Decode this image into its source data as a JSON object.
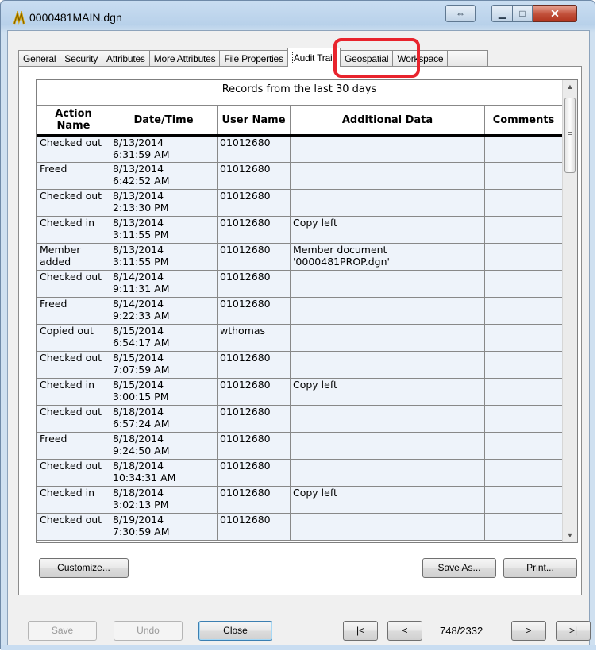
{
  "window": {
    "title": "0000481MAIN.dgn",
    "resize_glyph": "⇔",
    "minimize_glyph": "▁",
    "maximize_glyph": "□",
    "close_glyph": "✕"
  },
  "tabs": [
    {
      "label": "General"
    },
    {
      "label": "Security"
    },
    {
      "label": "Attributes"
    },
    {
      "label": "More Attributes"
    },
    {
      "label": "File Properties"
    },
    {
      "label": "Audit Trail",
      "active": true
    },
    {
      "label": "Geospatial"
    },
    {
      "label": "Workspace"
    },
    {
      "label": ""
    }
  ],
  "grid": {
    "caption": "Records from the last 30 days",
    "columns": {
      "action": "Action Name",
      "datetime": "Date/Time",
      "user": "User Name",
      "additional": "Additional Data",
      "comments": "Comments"
    },
    "rows": [
      {
        "action": "Checked out",
        "date": "8/13/2014",
        "time": "6:31:59 AM",
        "user": "01012680",
        "additional": "",
        "comments": ""
      },
      {
        "action": "Freed",
        "date": "8/13/2014",
        "time": "6:42:52 AM",
        "user": "01012680",
        "additional": "",
        "comments": ""
      },
      {
        "action": "Checked out",
        "date": "8/13/2014",
        "time": "2:13:30 PM",
        "user": "01012680",
        "additional": "",
        "comments": ""
      },
      {
        "action": "Checked in",
        "date": "8/13/2014",
        "time": "3:11:55 PM",
        "user": "01012680",
        "additional": "Copy left",
        "comments": ""
      },
      {
        "action": "Member added",
        "date": "8/13/2014",
        "time": "3:11:55 PM",
        "user": "01012680",
        "additional": "Member document '0000481PROP.dgn'",
        "comments": ""
      },
      {
        "action": "Checked out",
        "date": "8/14/2014",
        "time": "9:11:31 AM",
        "user": "01012680",
        "additional": "",
        "comments": ""
      },
      {
        "action": "Freed",
        "date": "8/14/2014",
        "time": "9:22:33 AM",
        "user": "01012680",
        "additional": "",
        "comments": ""
      },
      {
        "action": "Copied out",
        "date": "8/15/2014",
        "time": "6:54:17 AM",
        "user": "wthomas",
        "additional": "",
        "comments": ""
      },
      {
        "action": "Checked out",
        "date": "8/15/2014",
        "time": "7:07:59 AM",
        "user": "01012680",
        "additional": "",
        "comments": ""
      },
      {
        "action": "Checked in",
        "date": "8/15/2014",
        "time": "3:00:15 PM",
        "user": "01012680",
        "additional": "Copy left",
        "comments": ""
      },
      {
        "action": "Checked out",
        "date": "8/18/2014",
        "time": "6:57:24 AM",
        "user": "01012680",
        "additional": "",
        "comments": ""
      },
      {
        "action": "Freed",
        "date": "8/18/2014",
        "time": "9:24:50 AM",
        "user": "01012680",
        "additional": "",
        "comments": ""
      },
      {
        "action": "Checked out",
        "date": "8/18/2014",
        "time": "10:34:31 AM",
        "user": "01012680",
        "additional": "",
        "comments": ""
      },
      {
        "action": "Checked in",
        "date": "8/18/2014",
        "time": "3:02:13 PM",
        "user": "01012680",
        "additional": "Copy left",
        "comments": ""
      },
      {
        "action": "Checked out",
        "date": "8/19/2014",
        "time": "7:30:59 AM",
        "user": "01012680",
        "additional": "",
        "comments": ""
      }
    ]
  },
  "buttons": {
    "customize": "Customize...",
    "save_as": "Save As...",
    "print": "Print...",
    "save": "Save",
    "undo": "Undo",
    "close": "Close",
    "first": "|<",
    "prev": "<",
    "next": ">",
    "last": ">|"
  },
  "paging": {
    "counter": "748/2332"
  },
  "colors": {
    "highlight": "#e8242d",
    "row_background": "#eef3fa",
    "title_bar": "#c9ddf1"
  }
}
